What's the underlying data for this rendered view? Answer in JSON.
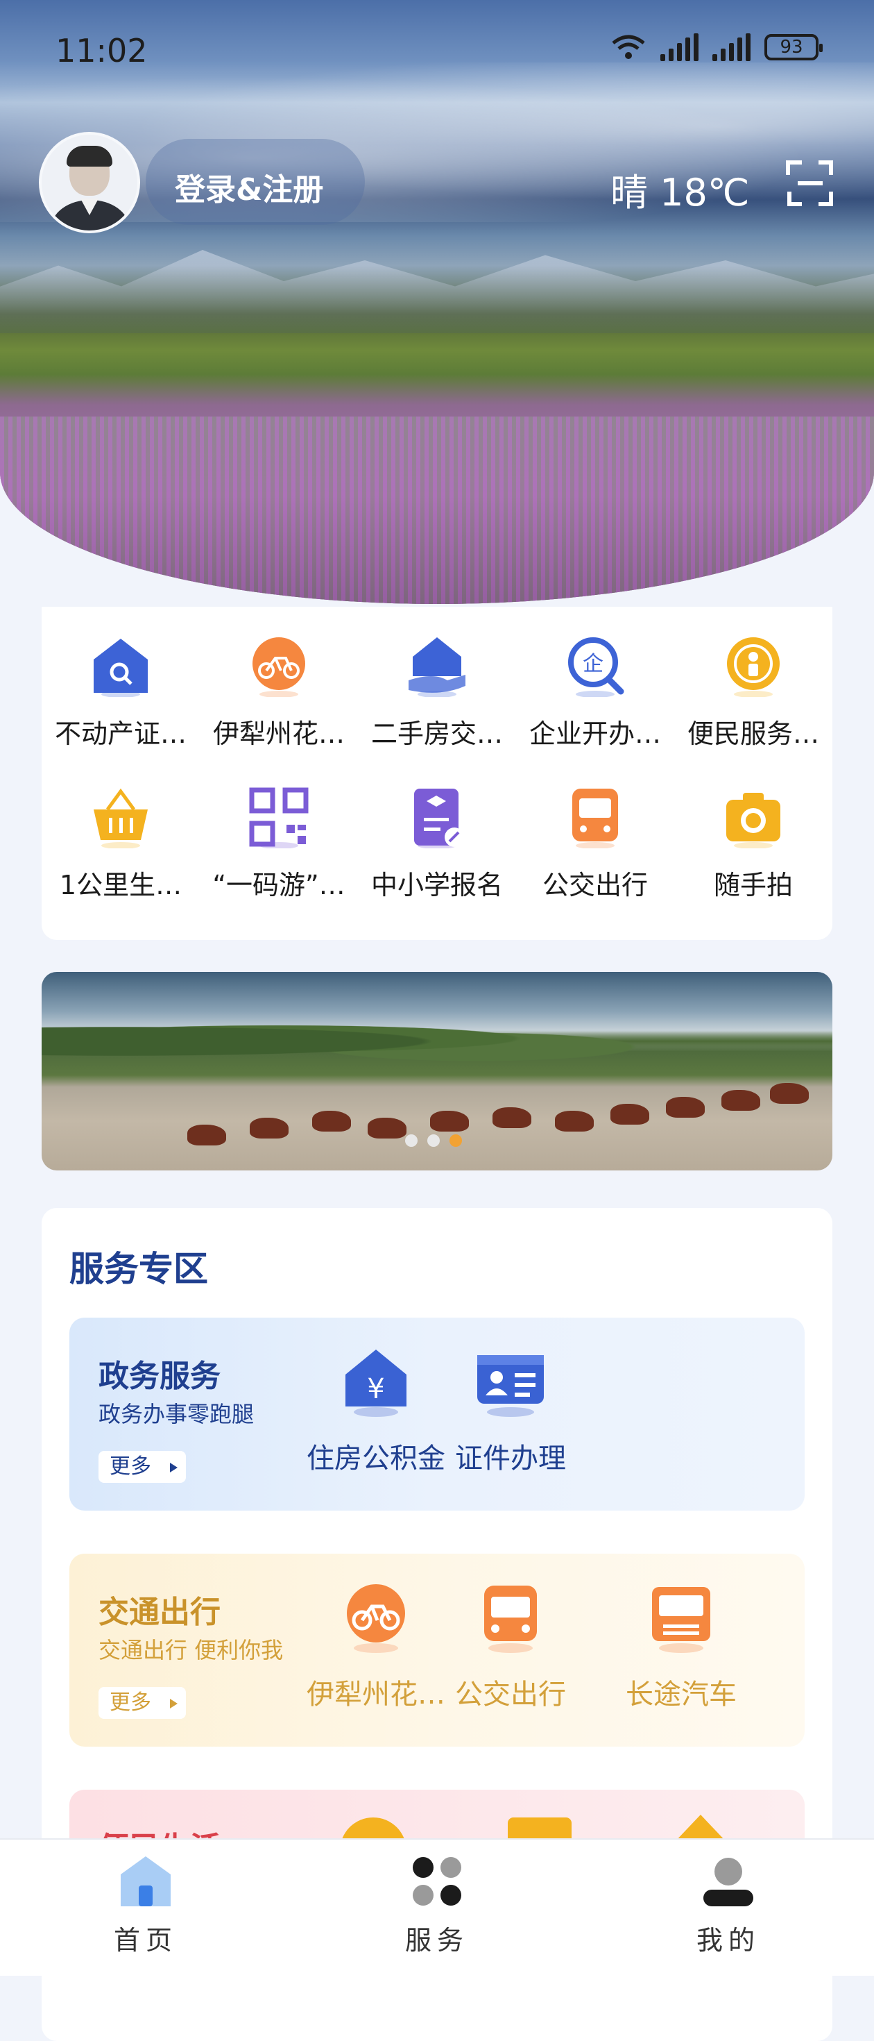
{
  "status_bar": {
    "time": "11:02",
    "battery": "93"
  },
  "header": {
    "login_text": "登录&注册",
    "weather": "晴 18℃"
  },
  "grid": [
    {
      "label": "不动产证…",
      "icon": "house-search-icon",
      "color": "#3d63d6"
    },
    {
      "label": "伊犁州花…",
      "icon": "bike-icon",
      "color": "#f5873f"
    },
    {
      "label": "二手房交…",
      "icon": "house-hand-icon",
      "color": "#3d63d6"
    },
    {
      "label": "企业开办…",
      "icon": "enterprise-search-icon",
      "color": "#3d63d6"
    },
    {
      "label": "便民服务…",
      "icon": "people-service-icon",
      "color": "#f4b21f"
    },
    {
      "label": "1公里生…",
      "icon": "basket-icon",
      "color": "#f4b21f"
    },
    {
      "label": "“一码游”…",
      "icon": "qr-code-icon",
      "color": "#7b5cd6"
    },
    {
      "label": "中小学报名",
      "icon": "school-form-icon",
      "color": "#7b5cd6"
    },
    {
      "label": "公交出行",
      "icon": "bus-icon",
      "color": "#f5873f"
    },
    {
      "label": "随手拍",
      "icon": "camera-icon",
      "color": "#f4b21f"
    }
  ],
  "banner": {
    "dot_count": 3,
    "active_dot": 2
  },
  "service_zone": {
    "title": "服务专区",
    "panels": [
      {
        "title": "政务服务",
        "subtitle": "政务办事零跑腿",
        "more": "更多",
        "title_color": "#1f3f8f",
        "sub_color": "#1f3f8f",
        "items": [
          {
            "label": "住房公积金",
            "icon": "housing-fund-icon"
          },
          {
            "label": "证件办理",
            "icon": "id-card-icon"
          }
        ]
      },
      {
        "title": "交通出行",
        "subtitle": "交通出行 便利你我",
        "more": "更多",
        "title_color": "#c9922a",
        "sub_color": "#d3a03a",
        "items": [
          {
            "label": "伊犁州花…",
            "icon": "bike-icon"
          },
          {
            "label": "公交出行",
            "icon": "bus-icon"
          },
          {
            "label": "长途汽车",
            "icon": "coach-icon"
          }
        ]
      },
      {
        "title": "便民生活",
        "subtitle": "",
        "more": "",
        "title_color": "#d9404a",
        "sub_color": "#d9404a",
        "items": []
      }
    ]
  },
  "tabbar": [
    {
      "label": "首页",
      "icon": "home-icon",
      "active": true
    },
    {
      "label": "服务",
      "icon": "services-grid-icon",
      "active": false
    },
    {
      "label": "我的",
      "icon": "profile-icon",
      "active": false
    }
  ]
}
